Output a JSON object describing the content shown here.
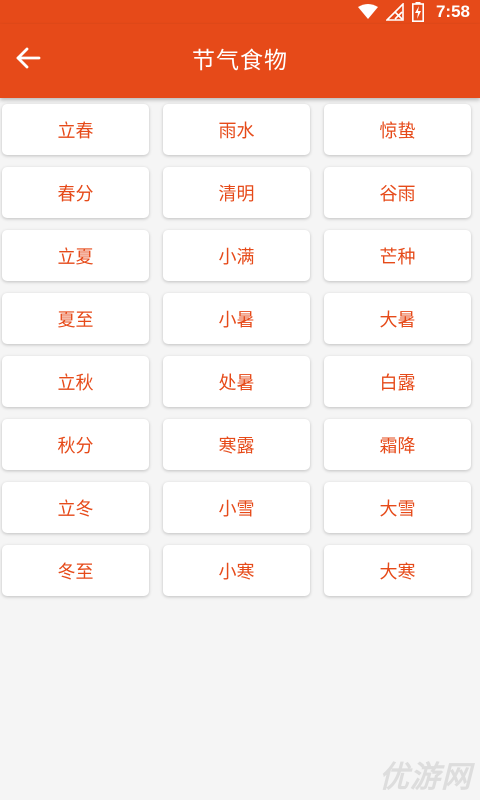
{
  "status_bar": {
    "time": "7:58",
    "icons": [
      "wifi-icon",
      "no-signal-icon",
      "battery-charging-icon"
    ]
  },
  "app_bar": {
    "back_icon": "arrow-left-icon",
    "title": "节气食物"
  },
  "colors": {
    "accent": "#e64a19",
    "background": "#f5f5f5",
    "card": "#ffffff"
  },
  "terms": [
    "立春",
    "雨水",
    "惊蛰",
    "春分",
    "清明",
    "谷雨",
    "立夏",
    "小满",
    "芒种",
    "夏至",
    "小暑",
    "大暑",
    "立秋",
    "处暑",
    "白露",
    "秋分",
    "寒露",
    "霜降",
    "立冬",
    "小雪",
    "大雪",
    "冬至",
    "小寒",
    "大寒"
  ],
  "watermark": "优游网"
}
